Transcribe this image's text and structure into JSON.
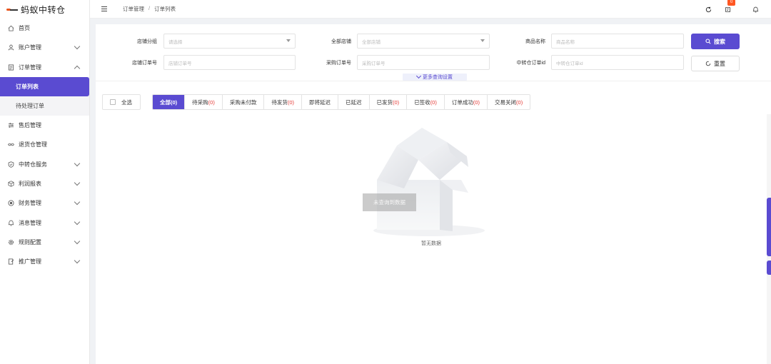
{
  "app": {
    "title": "蚂蚁中转仓"
  },
  "sidebar": {
    "items": [
      {
        "label": "首页",
        "icon": "home-icon"
      },
      {
        "label": "账户管理",
        "icon": "user-icon"
      },
      {
        "label": "订单管理",
        "icon": "order-icon"
      },
      {
        "label": "售后管理",
        "icon": "sliders-icon"
      },
      {
        "label": "退货仓管理",
        "icon": "handshake-icon"
      },
      {
        "label": "中转仓服务",
        "icon": "shield-icon"
      },
      {
        "label": "利润报表",
        "icon": "cube-icon"
      },
      {
        "label": "财务管理",
        "icon": "coin-icon"
      },
      {
        "label": "消息管理",
        "icon": "bell-icon"
      },
      {
        "label": "规则配置",
        "icon": "gear-icon"
      },
      {
        "label": "推广管理",
        "icon": "promo-icon"
      }
    ],
    "order_sub": [
      {
        "label": "订单列表",
        "active": true
      },
      {
        "label": "待处理订单",
        "active": false
      }
    ]
  },
  "topbar": {
    "breadcrumb": [
      "订单管理",
      "订单列表"
    ],
    "breadcrumb_sep": "/",
    "notification_count": "0"
  },
  "filters": {
    "shop_group": {
      "label": "店铺分组",
      "placeholder": "请选择"
    },
    "all_shops": {
      "label": "全部店铺",
      "placeholder": "全部店铺"
    },
    "product_name": {
      "label": "商品名称",
      "placeholder": "商品名称"
    },
    "shop_order_no": {
      "label": "店铺订单号",
      "placeholder": "店铺订单号"
    },
    "purchase_order_no": {
      "label": "采购订单号",
      "placeholder": "采购订单号"
    },
    "transit_order_id": {
      "label": "中转仓订单id",
      "placeholder": "中转仓订单id"
    },
    "search_label": "搜索",
    "reset_label": "重置",
    "more_label": "更多查询设置"
  },
  "select_all_label": "全选",
  "tabs": [
    {
      "label": "全部",
      "count": "(0)",
      "active": true
    },
    {
      "label": "待采购",
      "count": "(0)",
      "active": false
    },
    {
      "label": "采购未付款",
      "count": "",
      "active": false
    },
    {
      "label": "待发货",
      "count": "(0)",
      "active": false
    },
    {
      "label": "即将延迟",
      "count": "",
      "active": false
    },
    {
      "label": "已延迟",
      "count": "",
      "active": false
    },
    {
      "label": "已发货",
      "count": "(0)",
      "active": false
    },
    {
      "label": "已签收",
      "count": "(0)",
      "active": false
    },
    {
      "label": "订单成功",
      "count": "(0)",
      "active": false
    },
    {
      "label": "交易关闭",
      "count": "(0)",
      "active": false
    }
  ],
  "empty": {
    "overlay_text": "未查询到数据",
    "caption": "暂无数据"
  },
  "colors": {
    "accent": "#5a4bd1",
    "badge": "#ff5722",
    "count_red": "#e53935"
  }
}
